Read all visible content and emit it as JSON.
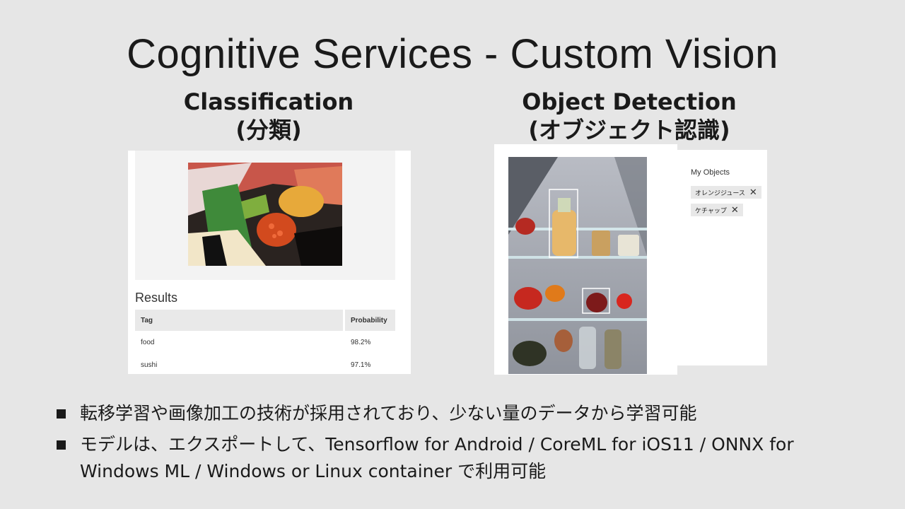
{
  "slide": {
    "title": "Cognitive Services - Custom Vision"
  },
  "classification": {
    "heading": "Classification",
    "subheading": "(分類)",
    "results_label": "Results",
    "table": {
      "headers": [
        "Tag",
        "Probability"
      ],
      "rows": [
        {
          "tag": "food",
          "probability": "98.2%"
        },
        {
          "tag": "sushi",
          "probability": "97.1%"
        }
      ]
    }
  },
  "object_detection": {
    "heading": "Object Detection",
    "subheading": "(オブジェクト認識)",
    "objects_label": "My Objects",
    "tags": [
      {
        "label": "オレンジジュース",
        "remove_icon": "close-icon"
      },
      {
        "label": "ケチャップ",
        "remove_icon": "close-icon"
      }
    ]
  },
  "bullets": [
    {
      "text": "転移学習や画像加工の技術が採用されており、少ない量のデータから学習可能"
    },
    {
      "text": "モデルは、エクスポートして、Tensorflow for Android / CoreML for iOS11 / ONNX for Windows ML / Windows or Linux container で利用可能"
    }
  ]
}
